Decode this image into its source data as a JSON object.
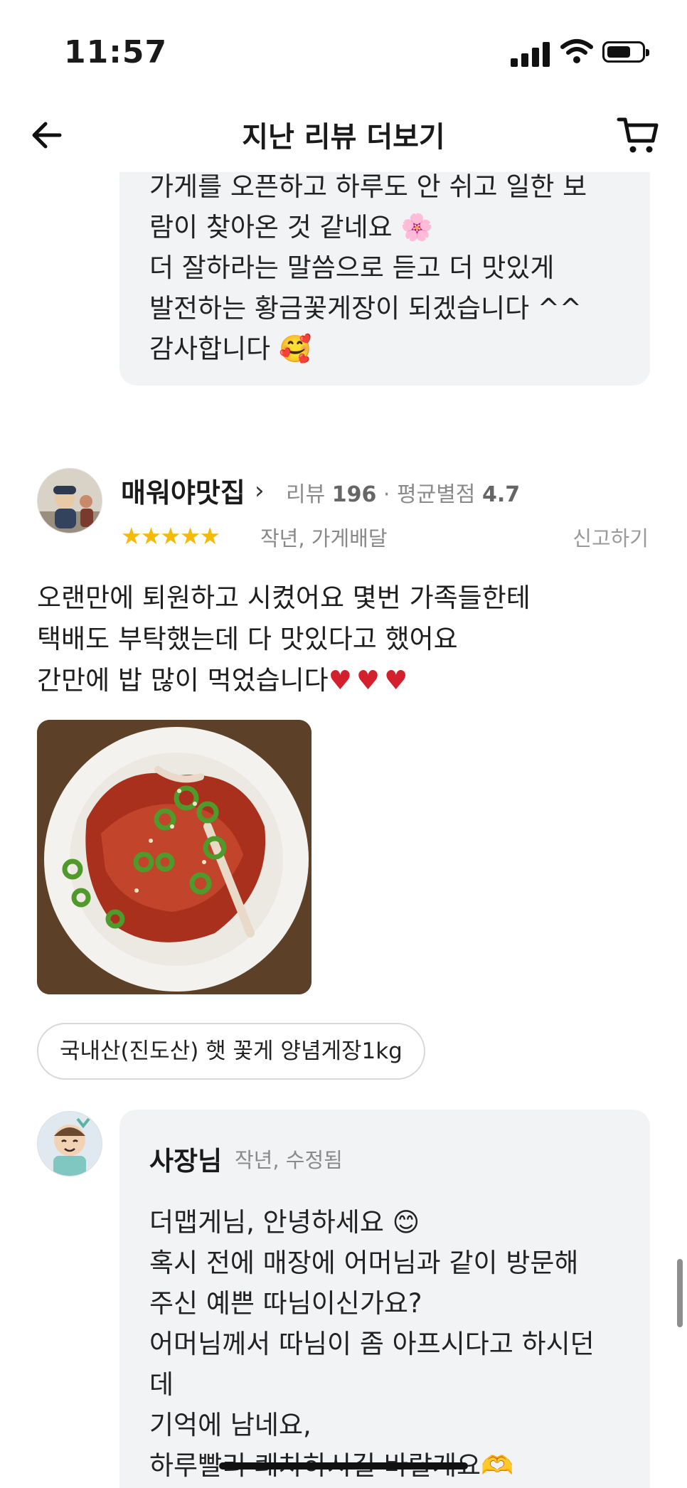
{
  "status_bar": {
    "time": "11:57"
  },
  "header": {
    "title": "지난 리뷰 더보기"
  },
  "previous_owner_reply": {
    "text": "가게를 오픈하고 하루도 안 쉬고 일한 보\n람이 찾아온 것 같네요 🌸\n더 잘하라는 말씀으로 듣고 더 맛있게\n발전하는 황금꽃게장이 되겠습니다 ^^\n감사합니다 🥰"
  },
  "review": {
    "reviewer_name": "매워야맛집",
    "review_count_label": "리뷰",
    "review_count": "196",
    "avg_rating_label": "평균별점",
    "avg_rating": "4.7",
    "stars": "★★★★★",
    "date_info": "작년, 가게배달",
    "report_label": "신고하기",
    "body": "오랜만에 퇴원하고 시켰어요 몇번 가족들한테\n택배도 부탁했는데 다 맛있다고 했어요\n간만에 밥 많이 먹었습니다",
    "hearts": "♥♥♥",
    "product_tag": "국내산(진도산) 햇 꽃게 양념게장1kg"
  },
  "owner_reply": {
    "name": "사장님",
    "date_info": "작년, 수정됨",
    "text": "더맵게님, 안녕하세요 😊\n혹시 전에 매장에 어머님과 같이 방문해\n주신 예쁜 따님이신가요?\n어머님께서 따님이 좀 아프시다고 하시던\n데\n기억에 남네요,\n하루빨리 쾌차하시길 바랄게요🫶"
  },
  "colors": {
    "star": "#f5b90a",
    "reply_bg": "#f2f3f5",
    "heart": "#d41f2c"
  }
}
